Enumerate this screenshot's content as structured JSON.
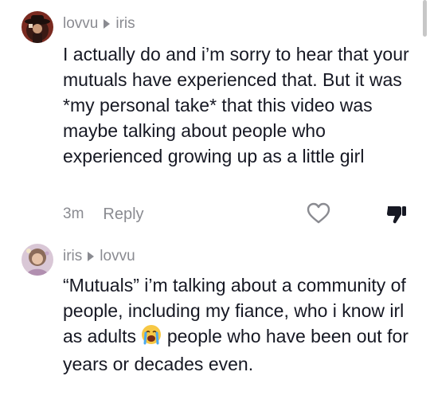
{
  "comments": [
    {
      "author": "lovvu",
      "reply_to": "iris",
      "text": "I actually do and i’m sorry to hear that your mutuals have experienced that. But it was *my personal take* that this video was maybe talking about people who experienced growing up as a little girl",
      "time": "3m",
      "reply_label": "Reply",
      "avatar_icon": "avatar-cowboy-hat-icon",
      "like_icon": "heart-outline-icon",
      "dislike_icon": "thumbs-down-icon"
    },
    {
      "author": "iris",
      "reply_to": "lovvu",
      "text_before_emoji": "“Mutuals” i’m talking about a community of people, including my fiance, who i know irl as adults",
      "emoji": "crying-face-emoji",
      "text_after_emoji": "people who have been out for years or decades even.",
      "avatar_icon": "avatar-photo-icon"
    }
  ],
  "colors": {
    "text": "#161823",
    "secondary": "#8a8b91",
    "background": "#ffffff"
  }
}
